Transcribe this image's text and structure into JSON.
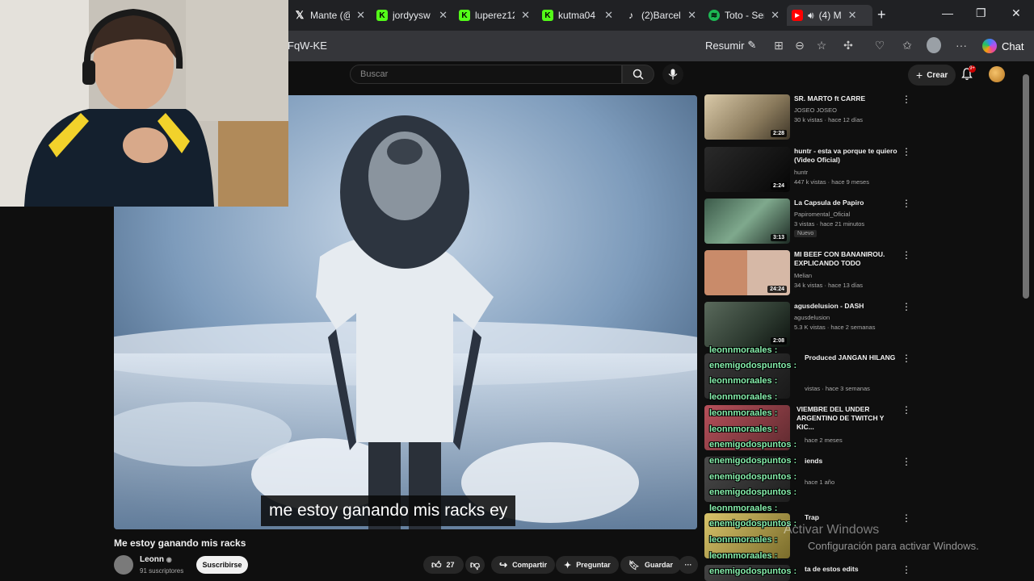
{
  "browser": {
    "tabs": [
      {
        "title": "Mante (@",
        "icon": "x-logo-icon",
        "color": "#ffffff"
      },
      {
        "title": "jordyysw",
        "icon": "kick-logo-icon",
        "color": "#53fc18"
      },
      {
        "title": "luperez12",
        "icon": "kick-logo-icon",
        "color": "#53fc18"
      },
      {
        "title": "kutma04",
        "icon": "kick-logo-icon",
        "color": "#53fc18"
      },
      {
        "title": "(2)Barcel",
        "icon": "tiktok-icon",
        "color": "#ffffff"
      },
      {
        "title": "Toto - Ser",
        "icon": "spotify-icon",
        "color": "#1db954"
      },
      {
        "title": "(4) M",
        "icon": "youtube-icon",
        "color": "#ff0000"
      }
    ],
    "url": "FqW-KE",
    "resumir_label": "Resumir",
    "chat_label": "Chat"
  },
  "youtube": {
    "search_placeholder": "Buscar",
    "create_label": "Crear",
    "notifications_count": "9+"
  },
  "video": {
    "caption": "me estoy ganando mis racks ey",
    "title": "Me estoy ganando mis racks",
    "channel": "Leonn",
    "subscribers": "91 suscriptores",
    "subscribe_label": "Suscribirse",
    "likes": "27",
    "share_label": "Compartir",
    "ask_label": "Preguntar",
    "save_label": "Guardar"
  },
  "recommendations": [
    {
      "title": "SR. MARTO ft CARRE",
      "channel": "JOSEO JOSEO",
      "meta": "30 k vistas · hace 12 días",
      "duration": "2:28",
      "badge": ""
    },
    {
      "title": "huntr - esta va porque te quiero (Video Oficial)",
      "channel": "huntr",
      "meta": "447 k vistas · hace 9 meses",
      "duration": "2:24",
      "badge": ""
    },
    {
      "title": "La  Capsula de Papiro",
      "channel": "Papiromental_Oficial",
      "meta": "3 vistas · hace 21 minutos",
      "duration": "3:13",
      "badge": "Nuevo"
    },
    {
      "title": "MI BEEF CON BANANIROU. EXPLICANDO TODO",
      "channel": "Melian",
      "meta": "34 k vistas · hace 13 días",
      "duration": "24:24",
      "badge": ""
    },
    {
      "title": "agusdelusion - DASH",
      "channel": "agusdelusion",
      "meta": "5.3 K vistas · hace 2 semanas",
      "duration": "2:08",
      "badge": ""
    },
    {
      "title": "Produced JANGAN HILANG",
      "channel": "",
      "meta": "vistas · hace 3 semanas",
      "duration": "",
      "badge": ""
    },
    {
      "title": "VIEMBRE DEL UNDER ARGENTINO DE TWITCH Y KIC...",
      "channel": "",
      "meta": "hace 2 meses",
      "duration": "",
      "badge": ""
    },
    {
      "title": "iends",
      "channel": "",
      "meta": "hace 1 año",
      "duration": "",
      "badge": ""
    },
    {
      "title": "Trap",
      "channel": "",
      "meta": "",
      "duration": "",
      "badge": ""
    },
    {
      "title": "ta de estos edits",
      "channel": "",
      "meta": "",
      "duration": "",
      "badge": ""
    }
  ],
  "chat_overlay": [
    {
      "user": "leonnmoraales :",
      "color": "#86efac"
    },
    {
      "user": "enemigodospuntos :",
      "color": "#86efac"
    },
    {
      "user": "leonnmoraales :",
      "color": "#86efac"
    },
    {
      "user": "leonnmoraales :",
      "color": "#86efac"
    },
    {
      "user": "leonnmoraales :",
      "color": "#86efac"
    },
    {
      "user": "leonnmoraales :",
      "color": "#86efac"
    },
    {
      "user": "enemigodospuntos :",
      "color": "#86efac"
    },
    {
      "user": "enemigodospuntos :",
      "color": "#86efac"
    },
    {
      "user": "enemigodospuntos :",
      "color": "#86efac"
    },
    {
      "user": "enemigodospuntos :",
      "color": "#86efac"
    },
    {
      "user": "leonnmoraales :",
      "color": "#86efac"
    },
    {
      "user": "enemigodospuntos :",
      "color": "#86efac"
    },
    {
      "user": "leonnmoraales :",
      "color": "#86efac"
    },
    {
      "user": "leonnmoraales :",
      "color": "#86efac"
    },
    {
      "user": "enemigodospuntos :",
      "color": "#86efac"
    }
  ],
  "windows_watermark": {
    "line1": "Activar Windows",
    "line2": "Configuración para activar Windows."
  }
}
